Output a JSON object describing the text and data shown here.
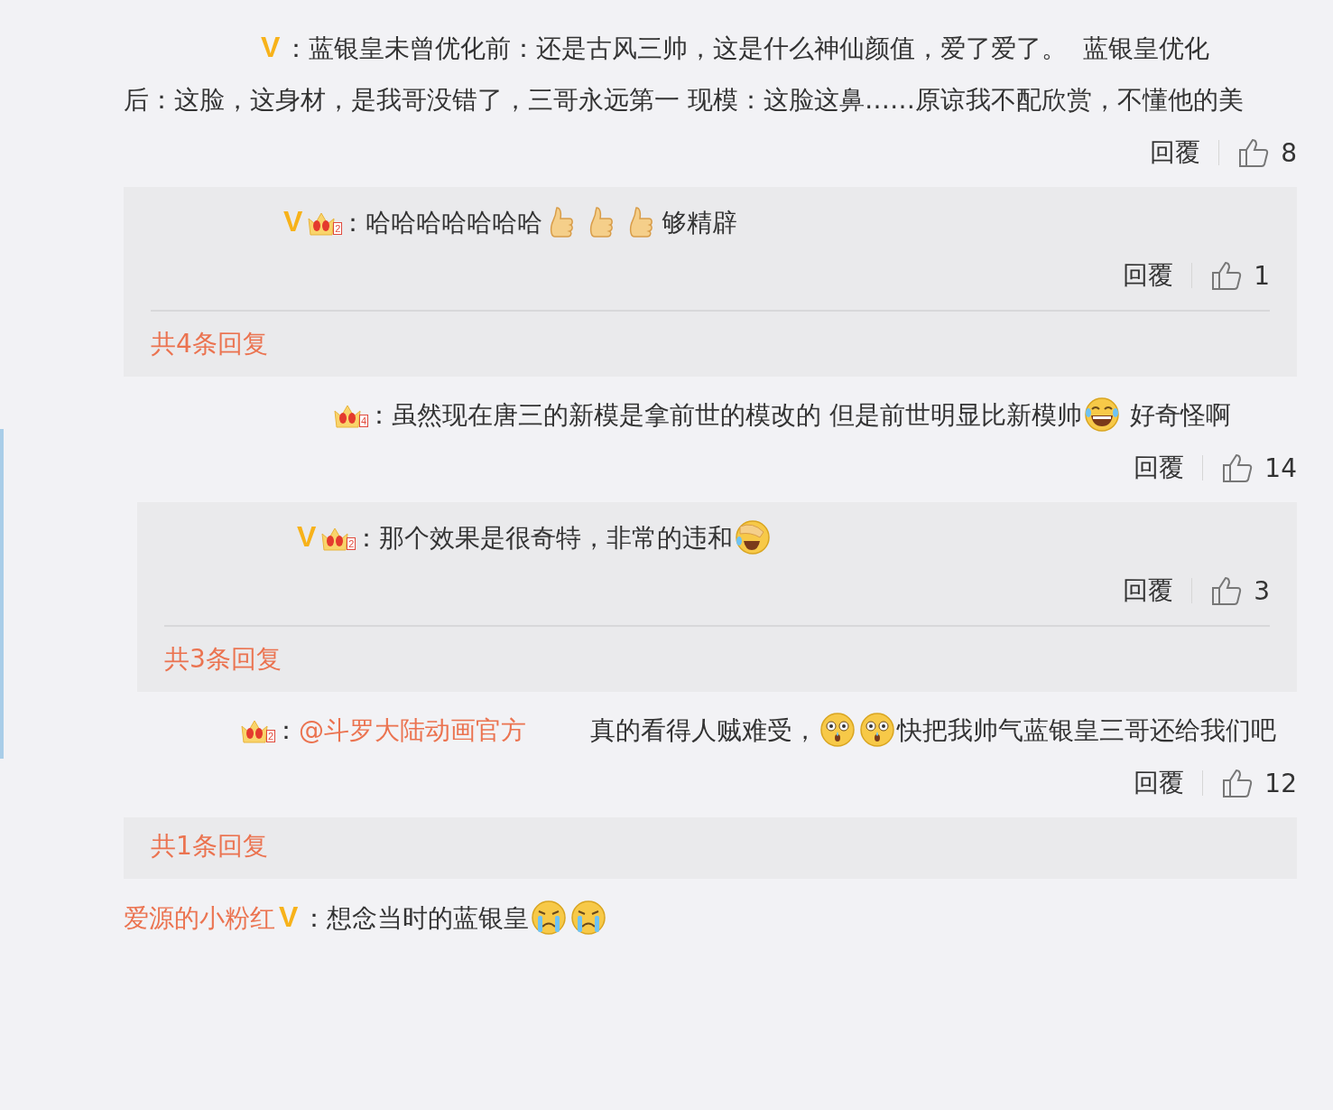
{
  "comments": [
    {
      "verified": "V",
      "segments": [
        {
          "kind": "text",
          "text": "：蓝银皇未曾优化前：还是古风三帅，这是什么神仙颜值，爱了爱了。  蓝银皇优化"
        },
        {
          "kind": "text",
          "text": "后：这脸，这身材，是我哥没错了，三哥永远第一 现模：这脸这鼻……原谅我不配欣赏，不懂他的"
        },
        {
          "kind": "text",
          "text": "美"
        }
      ],
      "reply_label": "回覆",
      "likes": "8",
      "thread": {
        "replies": [
          {
            "verified": "V",
            "level": "2",
            "segments": [
              {
                "kind": "text",
                "text": "：哈哈哈哈哈哈哈"
              },
              {
                "kind": "thumbs_up"
              },
              {
                "kind": "thumbs_up"
              },
              {
                "kind": "thumbs_up"
              },
              {
                "kind": "text",
                "text": "够精辟"
              }
            ],
            "reply_label": "回覆",
            "likes": "1"
          }
        ],
        "more": "共4条回复"
      }
    },
    {
      "level": "4",
      "segments": [
        {
          "kind": "text",
          "text": "：虽然现在唐三的新模是拿前世的模改的 但是前世明显比新模帅"
        },
        {
          "kind": "laugh_cry"
        },
        {
          "kind": "text",
          "text": " 好奇怪啊"
        }
      ],
      "reply_label": "回覆",
      "likes": "14",
      "thread": {
        "replies": [
          {
            "verified": "V",
            "level": "2",
            "segments": [
              {
                "kind": "text",
                "text": "：那个效果是很奇特，非常的违和"
              },
              {
                "kind": "facepalm_laugh"
              }
            ],
            "reply_label": "回覆",
            "likes": "3"
          }
        ],
        "more": "共3条回复"
      }
    },
    {
      "level": "2",
      "segments": [
        {
          "kind": "text",
          "text": "："
        },
        {
          "kind": "mention",
          "text": "@斗罗大陆动画官方"
        },
        {
          "kind": "text",
          "text": "        真的看得人贼难受，"
        },
        {
          "kind": "shocked"
        },
        {
          "kind": "shocked"
        },
        {
          "kind": "text",
          "text": "快把我帅气蓝银皇三哥还给我"
        },
        {
          "kind": "text",
          "text": "们吧"
        }
      ],
      "reply_label": "回覆",
      "likes": "12",
      "thread": {
        "more": "共1条回复"
      }
    },
    {
      "name": "爱源的小粉红",
      "verified": "V",
      "segments": [
        {
          "kind": "text",
          "text": "：想念当时的蓝银皇"
        },
        {
          "kind": "crying"
        },
        {
          "kind": "crying"
        }
      ]
    }
  ]
}
